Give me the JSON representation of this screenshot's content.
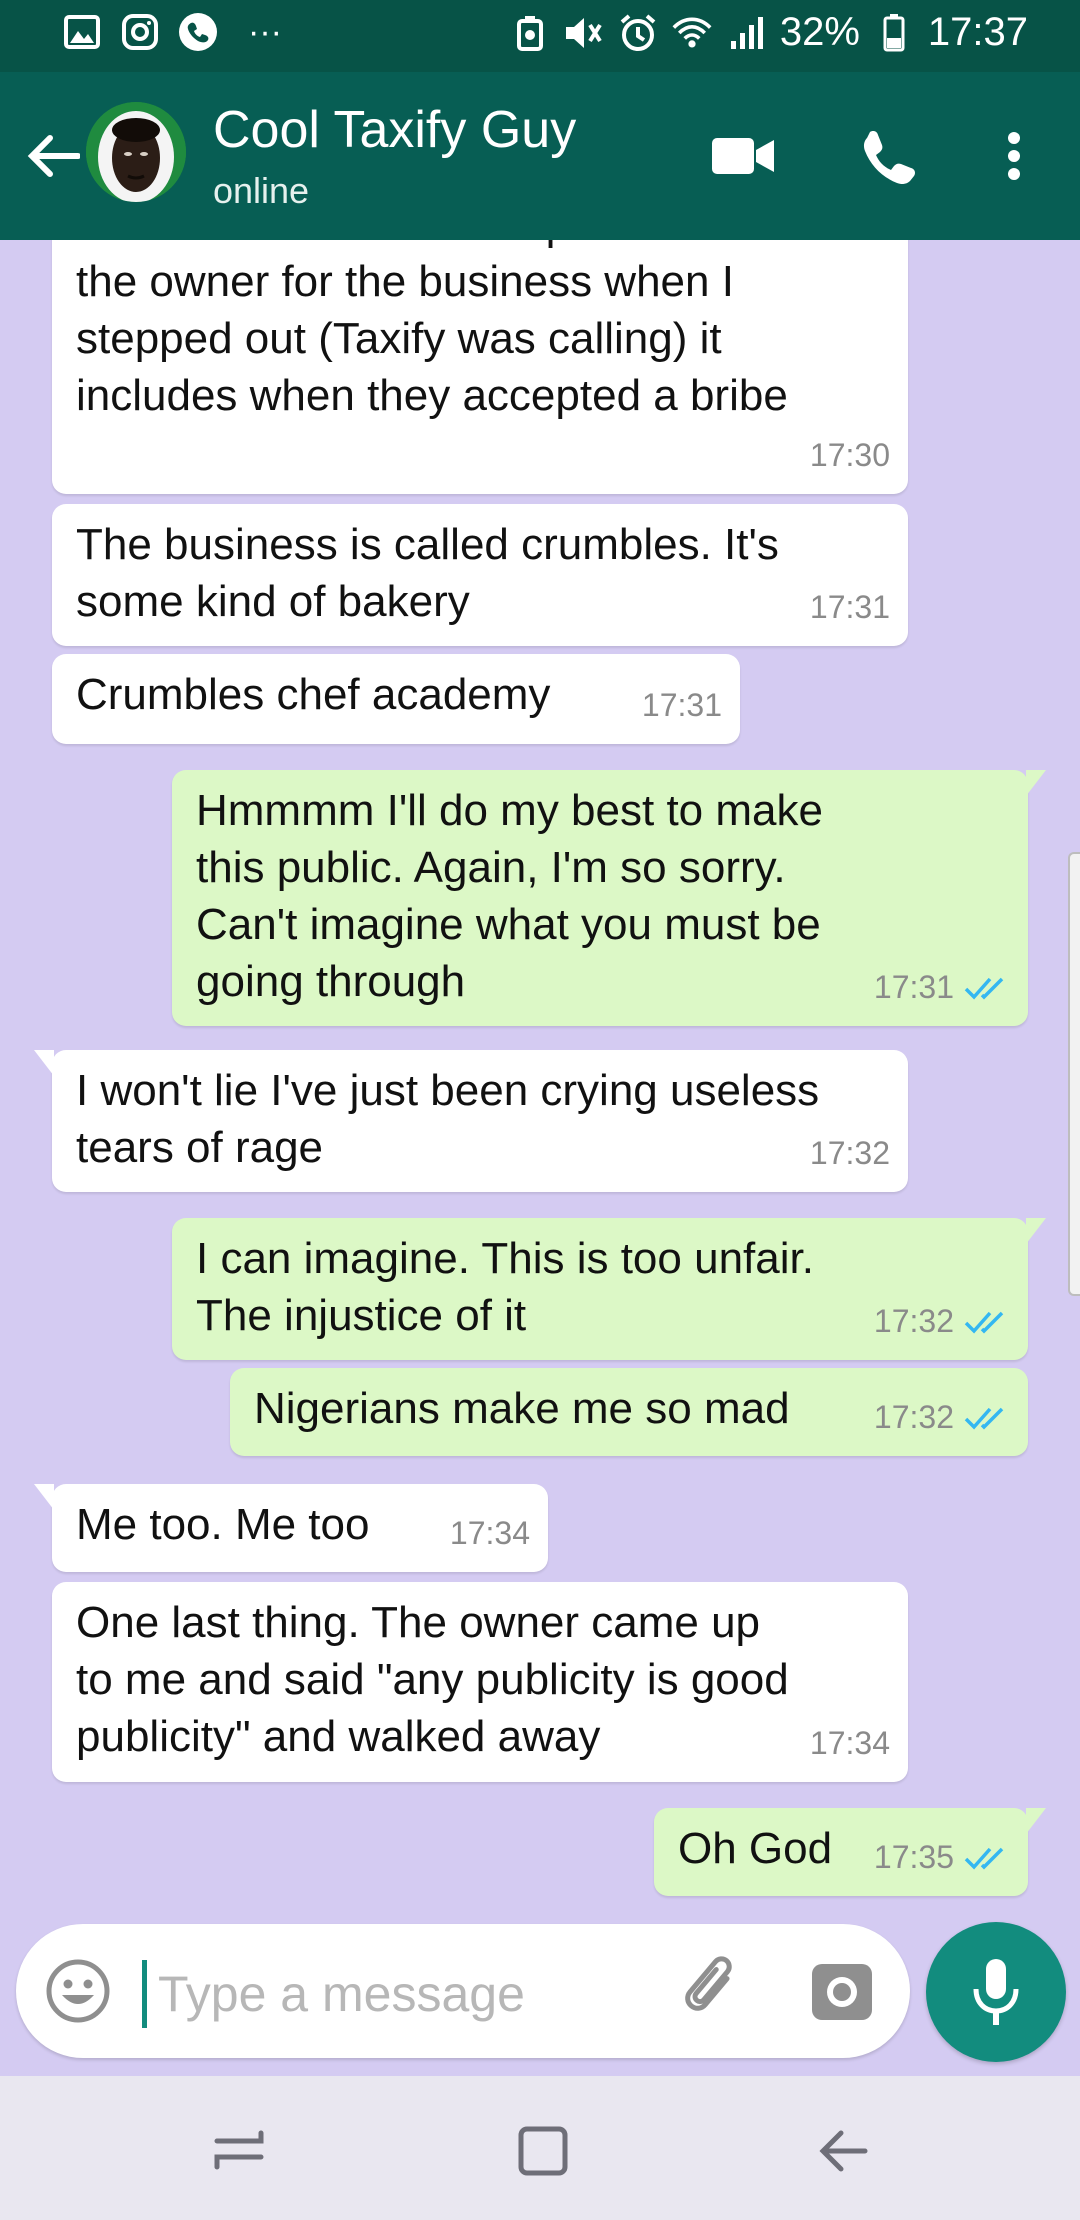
{
  "status_bar": {
    "battery": "32%",
    "time": "17:37",
    "more": "···"
  },
  "header": {
    "contact_name": "Cool Taxify Guy",
    "contact_status": "online"
  },
  "messages": [
    {
      "dir": "in",
      "text": "discussion between the police and\nthe owner for the business when I\nstepped out (Taxify was calling) it\nincludes when they accepted a bribe",
      "time": "17:30"
    },
    {
      "dir": "in",
      "text": "The business is called crumbles. It's\nsome kind of bakery",
      "time": "17:31"
    },
    {
      "dir": "in",
      "text": "Crumbles chef academy",
      "time": "17:31"
    },
    {
      "dir": "out",
      "text": "Hmmmm I'll do my best to make\nthis public. Again, I'm so sorry.\nCan't imagine what you must be\ngoing through",
      "time": "17:31",
      "read": true
    },
    {
      "dir": "in",
      "text": "I won't lie I've just been crying useless\ntears of rage",
      "time": "17:32"
    },
    {
      "dir": "out",
      "text": "I can imagine. This is too unfair.\nThe injustice of it",
      "time": "17:32",
      "read": true
    },
    {
      "dir": "out",
      "text": "Nigerians make me so mad",
      "time": "17:32",
      "read": true
    },
    {
      "dir": "in",
      "text": "Me too. Me too",
      "time": "17:34"
    },
    {
      "dir": "in",
      "text": "One last thing. The owner came up\nto me and said \"any publicity is good\npublicity\" and walked away",
      "time": "17:34"
    },
    {
      "dir": "out",
      "text": "Oh God",
      "time": "17:35",
      "read": true
    }
  ],
  "composer": {
    "placeholder": "Type a message"
  },
  "colors": {
    "header": "#075e54",
    "statusbar": "#075347",
    "chat_bg": "#d4cbf2",
    "outgoing": "#dcf8c6",
    "incoming": "#ffffff",
    "accent": "#128c7e",
    "read_ticks": "#34b7f1"
  },
  "icons": {
    "status_left": [
      "gallery-icon",
      "instagram-icon",
      "phone-notification-icon"
    ],
    "status_right": [
      "data-saver-icon",
      "mute-icon",
      "alarm-icon",
      "wifi-icon",
      "signal-icon",
      "battery-icon"
    ],
    "header": [
      "back-arrow-icon",
      "video-call-icon",
      "voice-call-icon",
      "more-options-icon"
    ],
    "composer": [
      "emoji-icon",
      "attach-icon",
      "camera-icon",
      "mic-icon"
    ],
    "navbar": [
      "recent-apps-icon",
      "home-icon",
      "back-icon"
    ]
  }
}
